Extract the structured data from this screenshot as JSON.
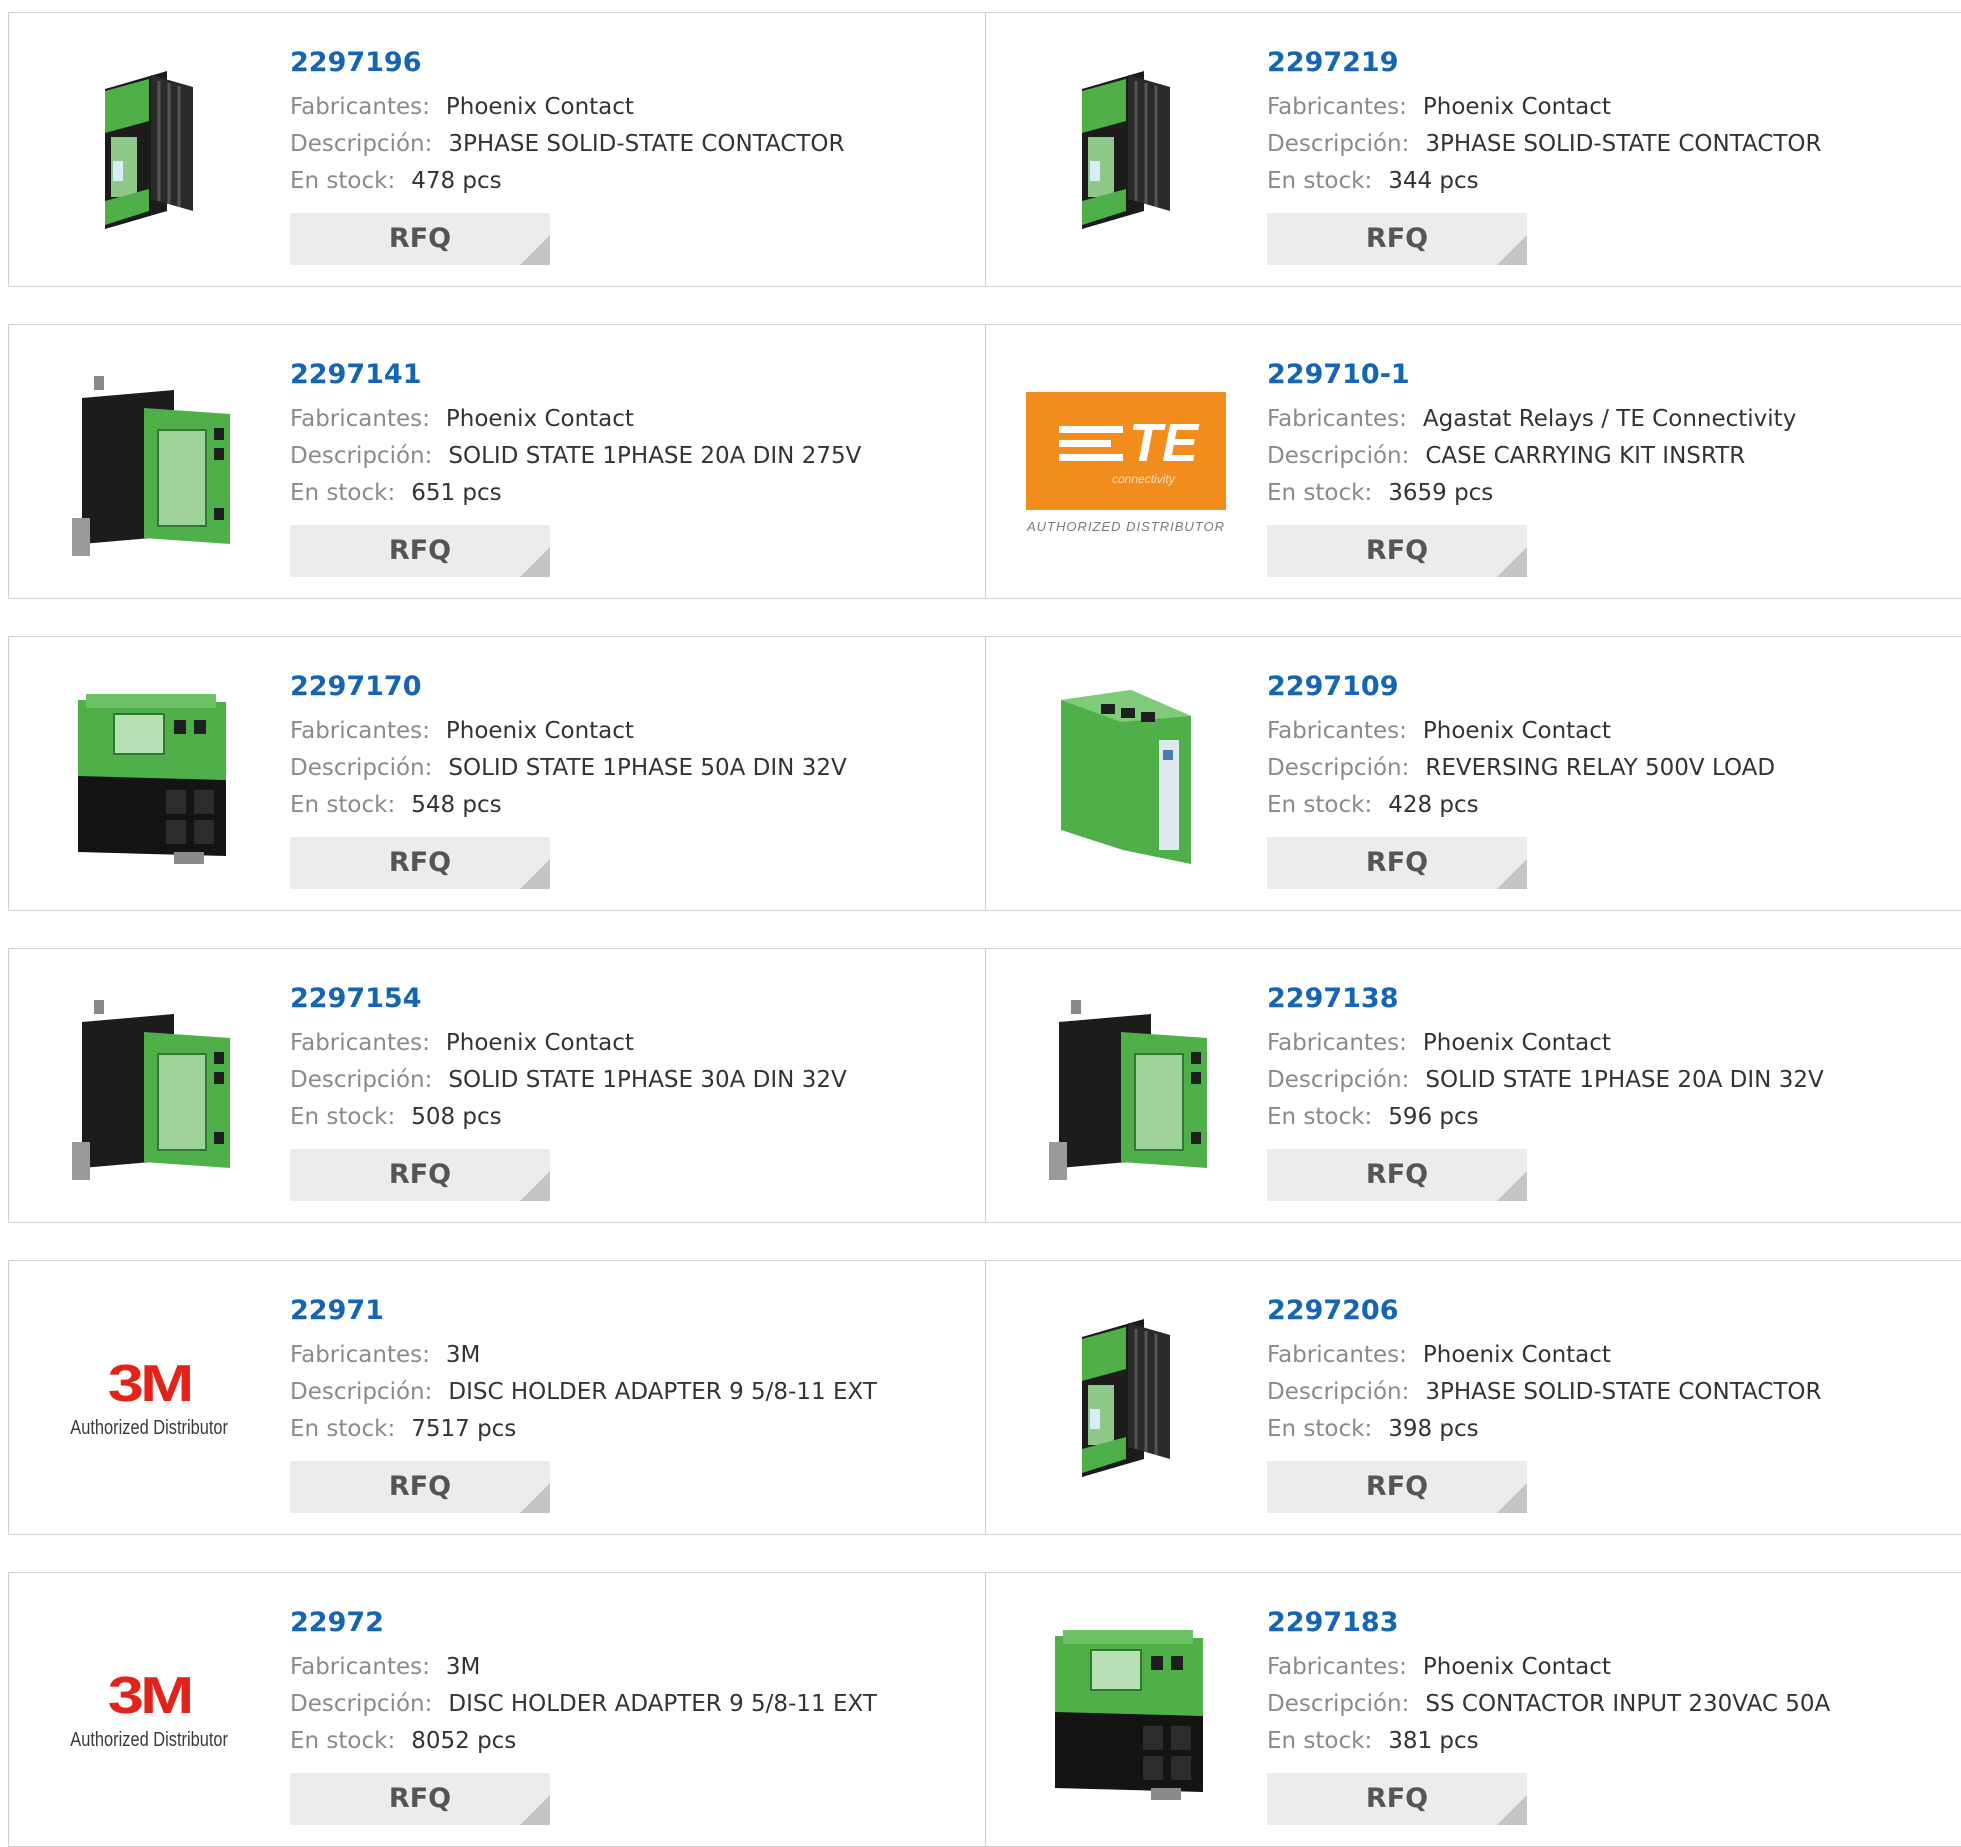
{
  "labels": {
    "manufacturer": "Fabricantes:",
    "description": "Descripción:",
    "stock": "En stock:",
    "rfq": "RFQ"
  },
  "colors": {
    "part_number": "#1565b2",
    "label": "#8a8a8a",
    "value": "#333333",
    "rfq_bg": "#ececec",
    "border": "#cfcfcf",
    "module_green": "#4fb04a",
    "te_orange": "#f28c1c",
    "logo_3m_red": "#e2231a"
  },
  "products": [
    {
      "part": "2297196",
      "manufacturer": "Phoenix Contact",
      "description": "3PHASE SOLID-STATE CONTACTOR",
      "stock": "478 pcs",
      "image": "relay-3phase-contactor"
    },
    {
      "part": "2297219",
      "manufacturer": "Phoenix Contact",
      "description": "3PHASE SOLID-STATE CONTACTOR",
      "stock": "344 pcs",
      "image": "relay-3phase-contactor"
    },
    {
      "part": "2297141",
      "manufacturer": "Phoenix Contact",
      "description": "SOLID STATE 1PHASE 20A DIN 275V",
      "stock": "651 pcs",
      "image": "relay-heatsink"
    },
    {
      "part": "229710-1",
      "manufacturer": "Agastat Relays / TE Connectivity",
      "description": "CASE CARRYING KIT INSRTR",
      "stock": "3659 pcs",
      "image": "logo-te",
      "logo": {
        "mark": "TE",
        "sub": "connectivity",
        "caption": "AUTHORIZED DISTRIBUTOR"
      }
    },
    {
      "part": "2297170",
      "manufacturer": "Phoenix Contact",
      "description": "SOLID STATE 1PHASE 50A DIN 32V",
      "stock": "548 pcs",
      "image": "relay-large-heatsink"
    },
    {
      "part": "2297109",
      "manufacturer": "Phoenix Contact",
      "description": "REVERSING RELAY 500V LOAD",
      "stock": "428 pcs",
      "image": "relay-reversing-module"
    },
    {
      "part": "2297154",
      "manufacturer": "Phoenix Contact",
      "description": "SOLID STATE 1PHASE 30A DIN 32V",
      "stock": "508 pcs",
      "image": "relay-heatsink"
    },
    {
      "part": "2297138",
      "manufacturer": "Phoenix Contact",
      "description": "SOLID STATE 1PHASE 20A DIN 32V",
      "stock": "596 pcs",
      "image": "relay-heatsink"
    },
    {
      "part": "22971",
      "manufacturer": "3M",
      "description": "DISC HOLDER ADAPTER 9 5/8-11 EXT",
      "stock": "7517 pcs",
      "image": "logo-3m",
      "logo": {
        "mark": "3M",
        "caption": "Authorized Distributor"
      }
    },
    {
      "part": "2297206",
      "manufacturer": "Phoenix Contact",
      "description": "3PHASE SOLID-STATE CONTACTOR",
      "stock": "398 pcs",
      "image": "relay-3phase-contactor"
    },
    {
      "part": "22972",
      "manufacturer": "3M",
      "description": "DISC HOLDER ADAPTER 9 5/8-11 EXT",
      "stock": "8052 pcs",
      "image": "logo-3m",
      "logo": {
        "mark": "3M",
        "caption": "Authorized Distributor"
      }
    },
    {
      "part": "2297183",
      "manufacturer": "Phoenix Contact",
      "description": "SS CONTACTOR INPUT 230VAC 50A",
      "stock": "381 pcs",
      "image": "relay-large-heatsink"
    }
  ]
}
